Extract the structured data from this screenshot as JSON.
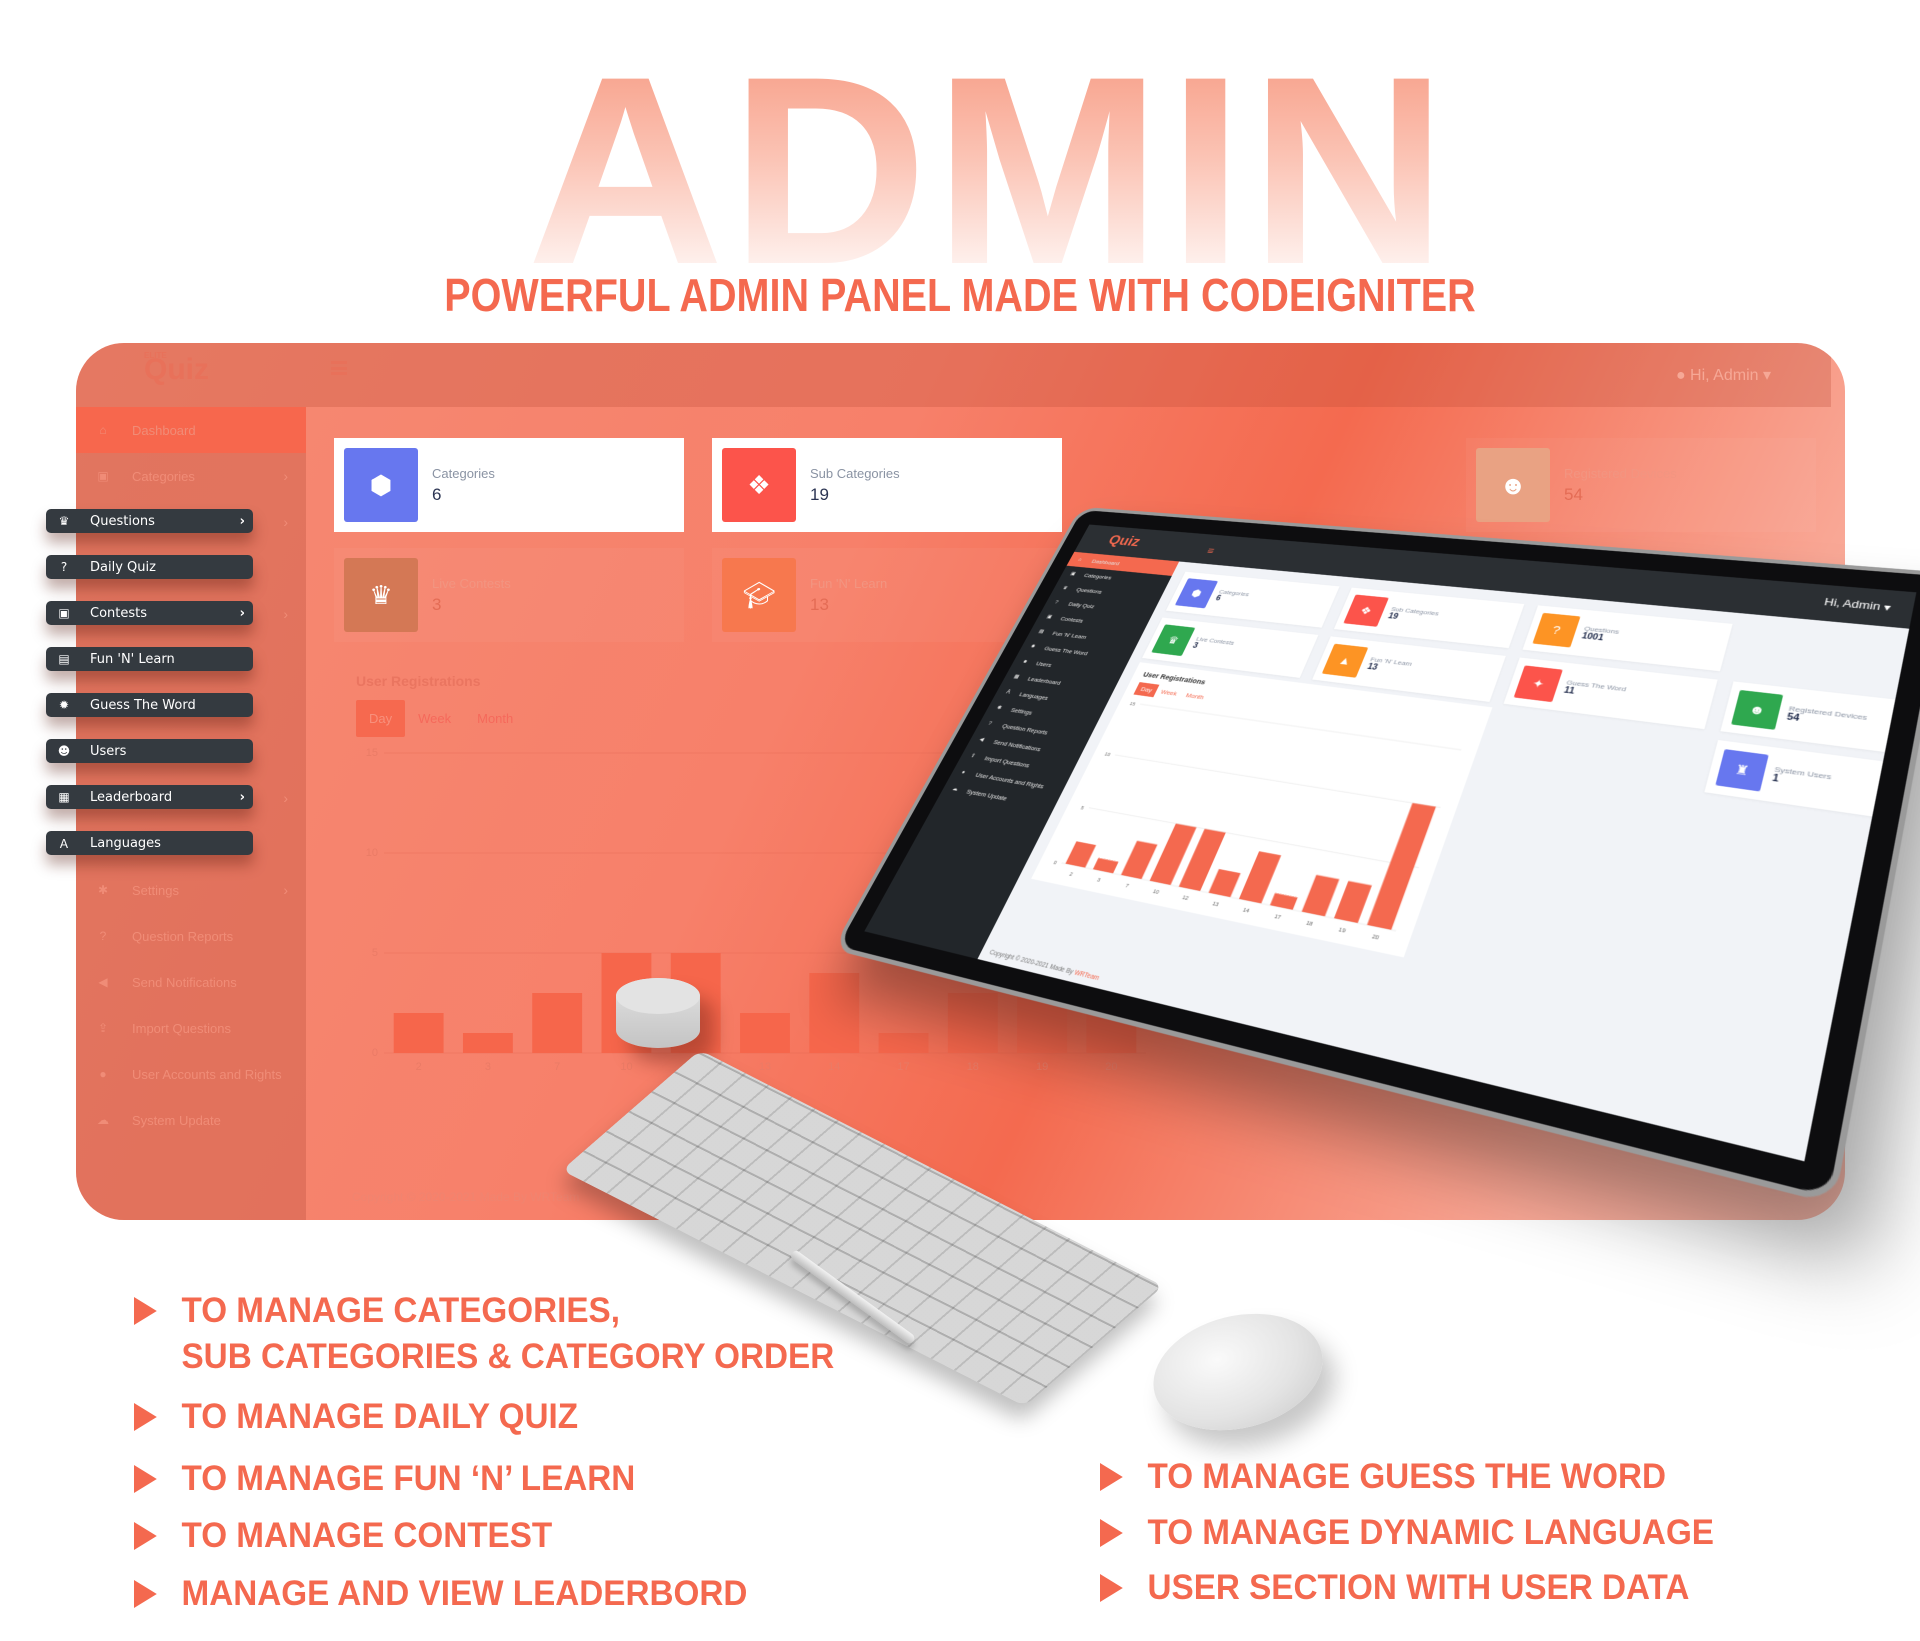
{
  "hero": {
    "title": "ADMIN PANEL",
    "subtitle": "POWERFUL ADMIN PANEL MADE WITH CODEIGNITER"
  },
  "colors": {
    "accent": "#f4694f",
    "sidebar_dark": "#343a40",
    "blue": "#6777ef",
    "red": "#fc544b",
    "green": "#2fa84f",
    "orange": "#fd9424"
  },
  "app": {
    "logo": "Quiz",
    "logo_small": "ELITE",
    "menu_toggle_icon": "hamburger-icon",
    "user_menu": "Hi, Admin",
    "copyright": "Copyright © 2020-2021 Made By ",
    "copyright_brand": "WRTeam"
  },
  "sidebar": {
    "items": [
      {
        "label": "Dashboard",
        "icon": "home-icon",
        "active": true,
        "chevron": false
      },
      {
        "label": "Categories",
        "icon": "gift-icon",
        "chevron": true
      },
      {
        "label": "Questions",
        "icon": "trophy-icon",
        "chevron": true
      },
      {
        "label": "Daily Quiz",
        "icon": "question-icon",
        "chevron": false
      },
      {
        "label": "Contests",
        "icon": "gift-icon",
        "chevron": true
      },
      {
        "label": "Fun 'N' Learn",
        "icon": "book-icon",
        "chevron": false
      },
      {
        "label": "Guess The Word",
        "icon": "cog-icon",
        "chevron": false
      },
      {
        "label": "Users",
        "icon": "users-icon",
        "chevron": false
      },
      {
        "label": "Leaderboard",
        "icon": "grid-icon",
        "chevron": true
      },
      {
        "label": "Languages",
        "icon": "language-icon",
        "chevron": false
      },
      {
        "label": "Settings",
        "icon": "gear-icon",
        "chevron": true
      },
      {
        "label": "Question Reports",
        "icon": "question-circle-icon",
        "chevron": false
      },
      {
        "label": "Send Notifications",
        "icon": "megaphone-icon",
        "chevron": false
      },
      {
        "label": "Import Questions",
        "icon": "upload-icon",
        "chevron": false
      },
      {
        "label": "User Accounts and Rights",
        "icon": "user-icon",
        "chevron": false
      },
      {
        "label": "System Update",
        "icon": "cloud-download-icon",
        "chevron": false
      }
    ]
  },
  "floating_menu": [
    {
      "label": "Questions",
      "icon": "trophy-icon",
      "chevron": true
    },
    {
      "label": "Daily Quiz",
      "icon": "question-icon",
      "chevron": false
    },
    {
      "label": "Contests",
      "icon": "gift-icon",
      "chevron": true
    },
    {
      "label": "Fun 'N' Learn",
      "icon": "book-icon",
      "chevron": false
    },
    {
      "label": "Guess The Word",
      "icon": "cog-icon",
      "chevron": false
    },
    {
      "label": "Users",
      "icon": "users-icon",
      "chevron": false
    },
    {
      "label": "Leaderboard",
      "icon": "grid-icon",
      "chevron": true
    },
    {
      "label": "Languages",
      "icon": "language-icon",
      "chevron": false
    }
  ],
  "stats": [
    {
      "label": "Categories",
      "value": "6",
      "icon": "cube-icon",
      "color": "#6777ef"
    },
    {
      "label": "Sub Categories",
      "value": "19",
      "icon": "cubes-icon",
      "color": "#fc544b"
    },
    {
      "label": "Questions",
      "value": "1001",
      "icon": "question-circle-icon",
      "color": "#fd9424"
    },
    {
      "label": "Live Contests",
      "value": "3",
      "icon": "trophy-icon",
      "color": "#2fa84f"
    },
    {
      "label": "Fun 'N' Learn",
      "value": "13",
      "icon": "graduation-cap-icon",
      "color": "#fd9424"
    },
    {
      "label": "Guess The Word",
      "value": "11",
      "icon": "lightbulb-icon",
      "color": "#fc544b"
    },
    {
      "label": "Registered Devices",
      "value": "54",
      "icon": "users-icon",
      "color": "#2fa84f"
    },
    {
      "label": "System Users",
      "value": "1",
      "icon": "user-secret-icon",
      "color": "#6777ef"
    }
  ],
  "registrations": {
    "title": "User Registrations",
    "tabs": [
      "Day",
      "Week",
      "Month"
    ],
    "active_tab": "Day"
  },
  "chart_data": {
    "type": "bar",
    "title": "User Registrations",
    "xlabel": "",
    "ylabel": "",
    "categories": [
      "2",
      "3",
      "7",
      "10",
      "12",
      "13",
      "14",
      "17",
      "18",
      "19",
      "20"
    ],
    "values": [
      2,
      1,
      3,
      5,
      5,
      2,
      4,
      1,
      3,
      3,
      10
    ],
    "yticks": [
      0,
      5,
      10,
      15
    ],
    "ylim": [
      0,
      15
    ],
    "grid": true,
    "color": "#f4694f"
  },
  "features_left": [
    "TO MANAGE CATEGORIES,\nSUB CATEGORIES & CATEGORY ORDER",
    "TO MANAGE DAILY QUIZ",
    "TO MANAGE FUN ‘N’ LEARN",
    "TO MANAGE CONTEST",
    "MANAGE AND VIEW LEADERBORD"
  ],
  "features_right": [
    "TO MANAGE GUESS THE WORD",
    "TO MANAGE DYNAMIC  LANGUAGE",
    "USER SECTION WITH USER DATA"
  ]
}
